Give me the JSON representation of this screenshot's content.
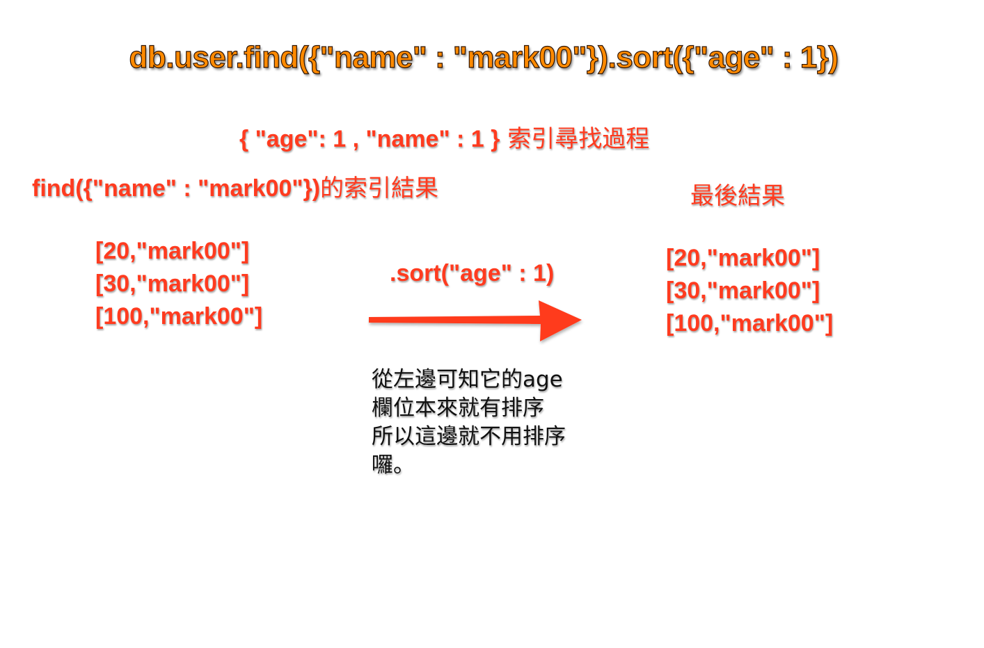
{
  "title": "db.user.find({\"name\" : \"mark00\"}).sort({\"age\" : 1})",
  "subtitle": {
    "code": "{ \"age\": 1 , \"name\" : 1 }",
    "text": " 索引尋找過程"
  },
  "left_panel": {
    "label_code": "find({\"name\" : \"mark00\"})",
    "label_text": "的索引結果",
    "items": [
      "[20,\"mark00\"]",
      "[30,\"mark00\"]",
      "[100,\"mark00\"]"
    ]
  },
  "operation": {
    "label": ".sort(\"age\" : 1)"
  },
  "right_panel": {
    "label": "最後結果",
    "items": [
      "[20,\"mark00\"]",
      "[30,\"mark00\"]",
      "[100,\"mark00\"]"
    ]
  },
  "note": {
    "lines": [
      "從左邊可知它的age",
      "欄位本來就有排序",
      "所以這邊就不用排序",
      "囉。"
    ]
  },
  "colors": {
    "title": "#ff8a00",
    "accent_red": "#ff3b1f",
    "note_text": "#111111",
    "background": "#ffffff"
  }
}
